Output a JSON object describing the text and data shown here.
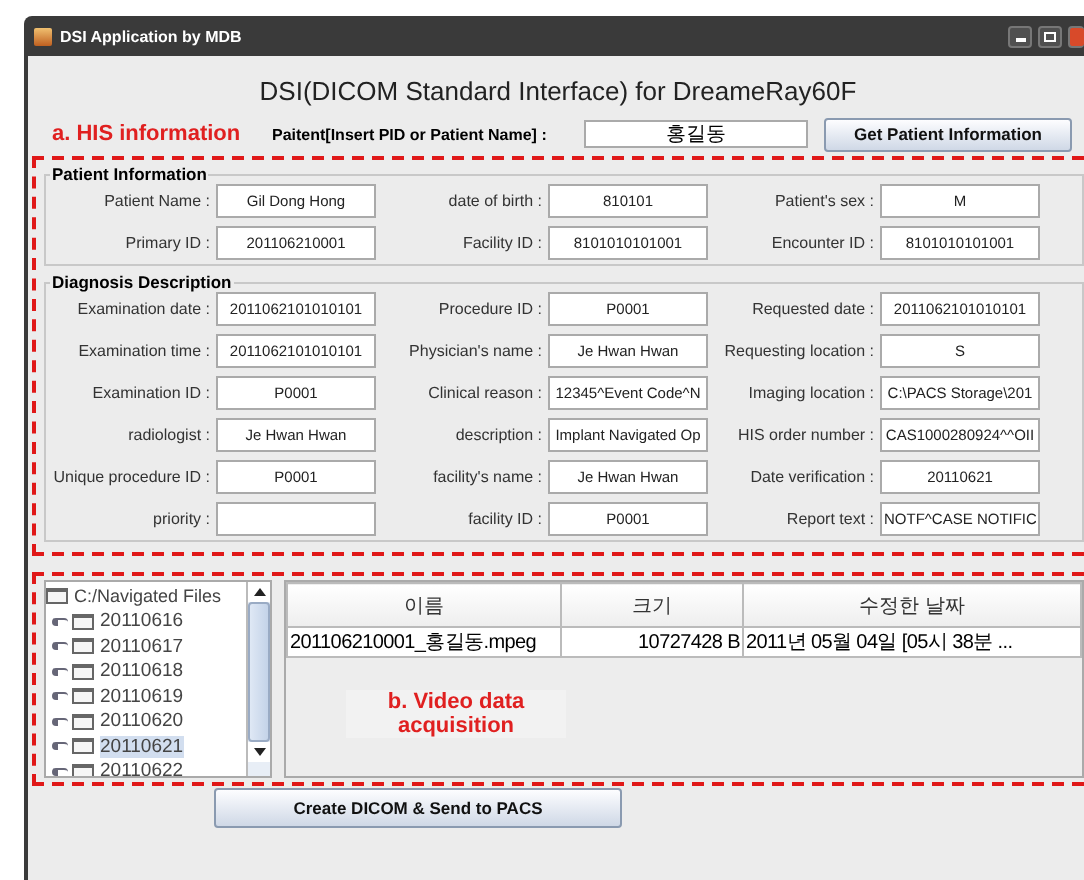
{
  "window": {
    "title": "DSI Application by MDB"
  },
  "heading": "DSI(DICOM Standard Interface) for DreameRay60F",
  "annotations": [
    {
      "text": "a. HIS information"
    },
    {
      "text": "b. Video data acquisition"
    }
  ],
  "patient_search": {
    "label": "Paitent[Insert PID or Patient Name] :",
    "value": "홍길동",
    "button": "Get Patient Information"
  },
  "groups": [
    {
      "title": "Patient Information",
      "fields": [
        {
          "label": "Patient Name :",
          "value": "Gil Dong Hong"
        },
        {
          "label": "date of birth :",
          "value": "810101"
        },
        {
          "label": "Patient's sex :",
          "value": "M"
        },
        {
          "label": "Primary ID :",
          "value": "201106210001"
        },
        {
          "label": "Facility ID :",
          "value": "8101010101001"
        },
        {
          "label": "Encounter ID :",
          "value": "8101010101001"
        }
      ]
    },
    {
      "title": "Diagnosis Description",
      "fields": [
        {
          "label": "Examination date :",
          "value": "2011062101010101"
        },
        {
          "label": "Procedure ID :",
          "value": "P0001"
        },
        {
          "label": "Requested date :",
          "value": "2011062101010101"
        },
        {
          "label": "Examination time :",
          "value": "2011062101010101"
        },
        {
          "label": "Physician's name :",
          "value": "Je Hwan Hwan"
        },
        {
          "label": "Requesting location :",
          "value": "S"
        },
        {
          "label": "Examination ID :",
          "value": "P0001"
        },
        {
          "label": "Clinical reason :",
          "value": "12345^Event Code^N"
        },
        {
          "label": "Imaging location :",
          "value": "C:\\PACS Storage\\201"
        },
        {
          "label": "radiologist :",
          "value": "Je Hwan Hwan"
        },
        {
          "label": "description :",
          "value": "Implant Navigated Op"
        },
        {
          "label": "HIS order number :",
          "value": "CAS1000280924^^OII"
        },
        {
          "label": "Unique procedure ID :",
          "value": "P0001"
        },
        {
          "label": "facility's name :",
          "value": "Je Hwan Hwan"
        },
        {
          "label": "Date verification :",
          "value": "20110621"
        },
        {
          "label": "priority :"
        },
        {
          "label": "facility ID :",
          "value": "P0001"
        },
        {
          "label": "Report text :",
          "value": "NOTF^CASE NOTIFIC"
        }
      ]
    }
  ],
  "file_tree": {
    "label": "C:/Navigated Files",
    "children": [
      {
        "label": "20110616",
        "selected": false
      },
      {
        "label": "20110617",
        "selected": false
      },
      {
        "label": "20110618",
        "selected": false
      },
      {
        "label": "20110619",
        "selected": false
      },
      {
        "label": "20110620",
        "selected": false
      },
      {
        "label": "20110621",
        "selected": true
      },
      {
        "label": "20110622",
        "selected": false
      }
    ]
  },
  "file_table": {
    "columns": [
      "이름",
      "크기",
      "수정한 날짜"
    ],
    "rows": [
      [
        "201106210001_홍길동.mpeg",
        "10727428 B",
        "2011년 05월 04일 [05시 38분 ..."
      ]
    ]
  },
  "action_button": "Create DICOM & Send to PACS"
}
